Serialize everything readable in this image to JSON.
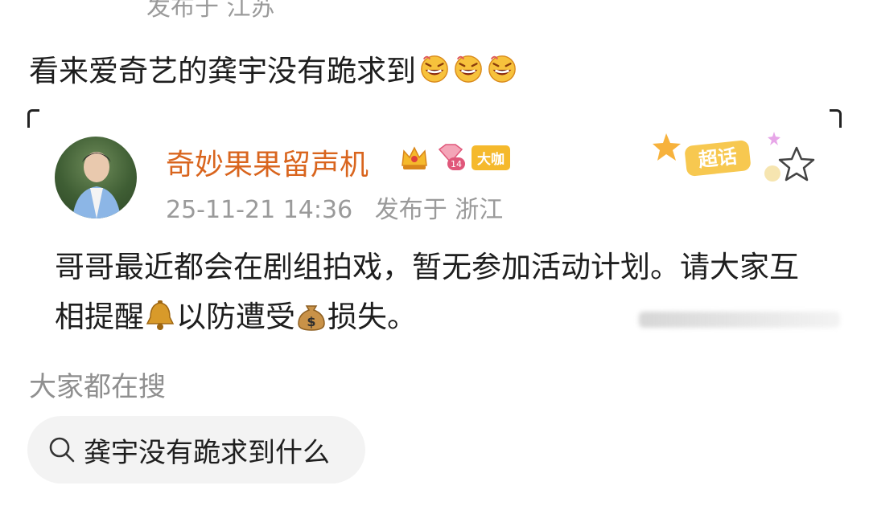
{
  "post": {
    "meta_top": "发布于 江苏",
    "text": "看来爱奇艺的龚宇没有跪求到"
  },
  "quoted": {
    "username": "奇妙果果留声机",
    "badge": "大咖",
    "time": "25-11-21 14:36",
    "location": "发布于 浙江",
    "chaohua_label": "超话",
    "body_part1": "哥哥最近都会在剧组拍戏，暂无参加活动计划。请大家互相提醒",
    "body_part2": "以防遭受",
    "body_part3": "损失。"
  },
  "search": {
    "section_title": "大家都在搜",
    "chip_text": "龚宇没有跪求到什么"
  },
  "colors": {
    "username": "#d9651e",
    "meta": "#9a9a9a",
    "badge": "#f5b92c",
    "chip_bg": "#f3f3f3"
  },
  "icons": [
    "laughing-emoji-icon",
    "crown-icon",
    "diamond-level-icon",
    "chaohua-badge-icon",
    "star-outline-icon",
    "bell-emoji-icon",
    "money-bag-emoji-icon",
    "search-icon"
  ]
}
